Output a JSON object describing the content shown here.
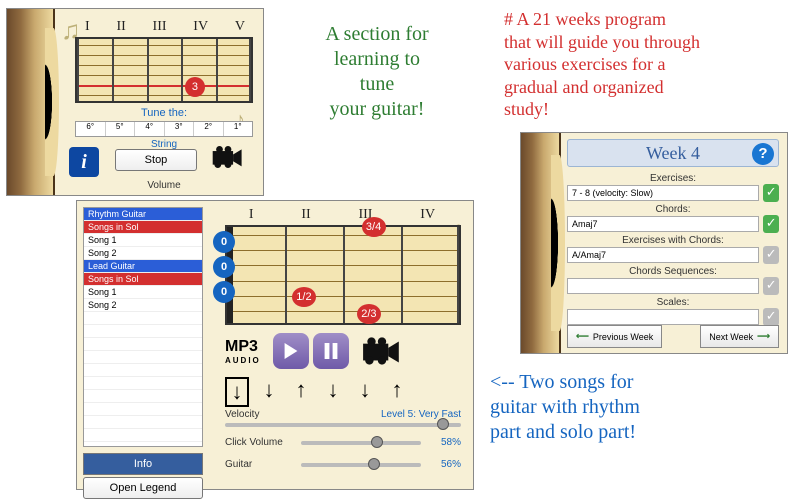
{
  "callouts": {
    "green": "A section for\nlearning to\ntune\nyour guitar!",
    "red": "# A 21 weeks program\nthat will guide you through\nvarious exercises for a\ngradual and organized\nstudy!",
    "blue": "<-- Two songs for\nguitar with rhythm\npart and solo part!"
  },
  "tuner": {
    "roman": [
      "I",
      "II",
      "III",
      "IV",
      "V"
    ],
    "marker": "3",
    "tune_label": "Tune the:",
    "string_values": [
      "6°",
      "5°",
      "4°",
      "3°",
      "2°",
      "1°"
    ],
    "string_caption": "String",
    "stop_btn": "Stop",
    "volume_label": "Volume"
  },
  "songs": {
    "list": [
      {
        "cls": "lr-blue",
        "t": "Rhythm Guitar"
      },
      {
        "cls": "lr-red",
        "t": "Songs in Sol"
      },
      {
        "cls": "",
        "t": "Song 1"
      },
      {
        "cls": "",
        "t": "Song 2"
      },
      {
        "cls": "lr-blue",
        "t": "Lead Guitar"
      },
      {
        "cls": "lr-red",
        "t": "Songs in Sol"
      },
      {
        "cls": "",
        "t": "Song 1"
      },
      {
        "cls": "",
        "t": "Song 2"
      }
    ],
    "info_heading": "Info",
    "open_legend": "Open Legend",
    "roman": [
      "I",
      "II",
      "III",
      "IV"
    ],
    "finger_zero": "0",
    "markers": {
      "top": "3/4",
      "mid": "1/2",
      "low": "2/3"
    },
    "mp3": "MP3",
    "mp3_sub": "AUDIO",
    "velocity_label": "Velocity",
    "velocity_value": "Level 5: Very Fast",
    "click_vol_label": "Click Volume",
    "click_vol_pct": "58%",
    "guitar_label": "Guitar",
    "guitar_pct": "56%"
  },
  "weeks": {
    "title": "Week 4",
    "rows": [
      {
        "label": "Exercises:",
        "value": "7 - 8 (velocity: Slow)",
        "chk": "green"
      },
      {
        "label": "Chords:",
        "value": "Amaj7",
        "chk": "green"
      },
      {
        "label": "Exercises with Chords:",
        "value": "A/Amaj7",
        "chk": "grey"
      },
      {
        "label": "Chords Sequences:",
        "value": "",
        "chk": "grey"
      },
      {
        "label": "Scales:",
        "value": "",
        "chk": "grey"
      }
    ],
    "prev": "Previous Week",
    "next": "Next Week"
  }
}
